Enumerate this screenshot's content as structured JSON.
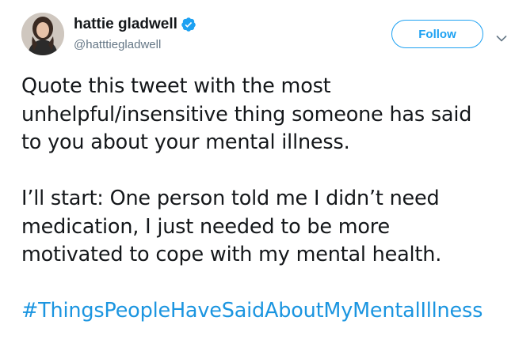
{
  "tweet": {
    "author": {
      "display_name": "hattie gladwell",
      "handle": "@hatttiegladwell",
      "verified": true,
      "avatar_icon": "user-avatar-photo"
    },
    "follow_label": "Follow",
    "menu_icon": "chevron-down-icon",
    "paragraph_1_lines": [
      "Quote this tweet with the most",
      "unhelpful/insensitive thing someone has said",
      "to you about your mental illness."
    ],
    "paragraph_2_lines": [
      "I’ll start: One person told me I didn’t need",
      "medication, I just needed to be more",
      "motivated to cope with my mental health."
    ],
    "hashtag": "#ThingsPeopleHaveSaidAboutMyMentalIllness"
  },
  "colors": {
    "text": "#14171a",
    "secondary": "#657786",
    "accent": "#1da1f2",
    "link": "#1b95e0"
  }
}
